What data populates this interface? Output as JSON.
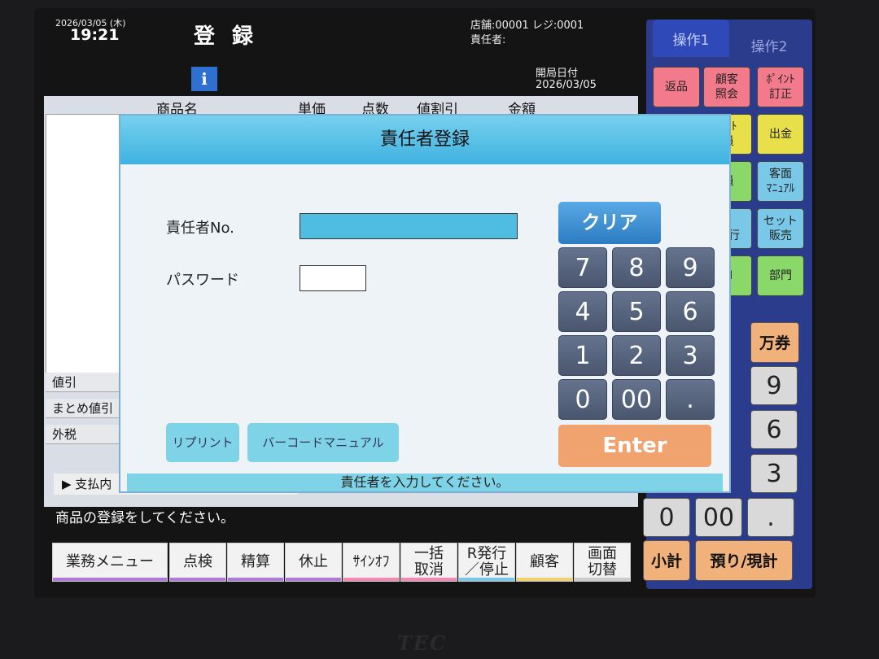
{
  "header": {
    "date": "2026/03/05 (木)",
    "time": "19:21",
    "title": "登 録",
    "store_reg": "店舗:00001  レジ:0001",
    "manager": "責任者:",
    "info_icon": "i",
    "open_date_label": "開局日付",
    "open_date": "2026/03/05"
  },
  "table": {
    "columns": [
      "商品名",
      "単価",
      "点数",
      "値割引",
      "金額"
    ],
    "side_labels": [
      "値引",
      "まとめ値引",
      "外税"
    ],
    "payment_label": "▶ 支払内"
  },
  "status_message": "商品の登録をしてください。",
  "function_bar": [
    {
      "label": "業務メニュー",
      "line": "#b07ad8"
    },
    {
      "label": "点検",
      "line": "#b07ad8"
    },
    {
      "label": "精算",
      "line": "#b07ad8"
    },
    {
      "label": "休止",
      "line": "#b07ad8"
    },
    {
      "label": "ｻｲﾝｵﾌ",
      "line": "#f08ab0"
    },
    {
      "label": "一括\n取消",
      "line": "#f08ab0"
    },
    {
      "label": "R発行\n／停止",
      "line": "#7ac8e8"
    },
    {
      "label": "顧客",
      "line": "#f0d070"
    },
    {
      "label": "画面\n切替",
      "line": "#cccccc"
    }
  ],
  "right_panel": {
    "tab1": "操作1",
    "tab2": "操作2",
    "keys": [
      {
        "label": "返品",
        "color": "#f27a8a"
      },
      {
        "label": "顧客\n照会",
        "color": "#f27a8a"
      },
      {
        "label": "ﾎﾟｲﾝﾄ\n訂正",
        "color": "#f27a8a"
      },
      {
        "label": "ｼｰﾄ\n員",
        "color": "#e8e04a"
      },
      {
        "label": "出金",
        "color": "#e8e04a"
      },
      {
        "label": "員",
        "color": "#8ad86a"
      },
      {
        "label": "客面\nﾏﾆｭｱﾙ",
        "color": "#7ac8e8"
      },
      {
        "label": "ﾄ\n発行",
        "color": "#7ac8e8"
      },
      {
        "label": "セット\n販売",
        "color": "#7ac8e8"
      },
      {
        "label": "N",
        "color": "#8ad86a"
      },
      {
        "label": "部門",
        "color": "#8ad86a"
      }
    ],
    "man_key": "万券",
    "num_keys": [
      "9",
      "6",
      "3"
    ],
    "bottom_keys": [
      "0",
      "00",
      "."
    ],
    "subtotal": "小計",
    "deposit": "預り/現計"
  },
  "dialog": {
    "title": "責任者登録",
    "manager_no_label": "責任者No.",
    "manager_no_value": "",
    "password_label": "パスワード",
    "password_value": "",
    "clear": "クリア",
    "keypad": [
      "7",
      "8",
      "9",
      "4",
      "5",
      "6",
      "1",
      "2",
      "3",
      "0",
      "00",
      "."
    ],
    "enter": "Enter",
    "reprint": "リプリント",
    "barcode_manual": "バーコードマニュアル",
    "status": "責任者を入力してください。"
  },
  "bezel_logo": "TEC"
}
